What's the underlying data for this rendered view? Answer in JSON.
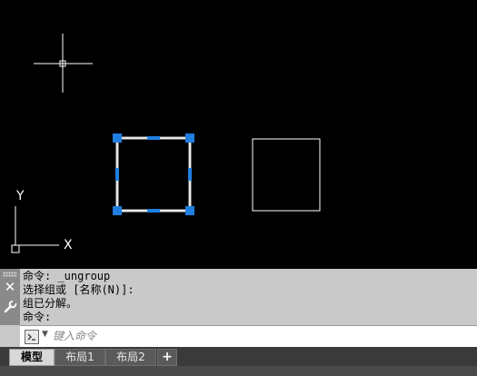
{
  "canvas": {
    "ucs_x_label": "X",
    "ucs_y_label": "Y",
    "colors": {
      "background": "#000000",
      "geometry": "#ffffff",
      "grip": "#1e7fe0",
      "selected": "#d0d0d0"
    }
  },
  "command_history": {
    "lines": [
      "命令: _ungroup",
      "选择组或 [名称(N)]:",
      "组已分解。",
      "命令:"
    ]
  },
  "command_input": {
    "placeholder": "键入命令"
  },
  "layout_tabs": [
    {
      "label": "模型",
      "active": true
    },
    {
      "label": "布局1",
      "active": false
    },
    {
      "label": "布局2",
      "active": false
    }
  ],
  "add_tab_label": "+"
}
